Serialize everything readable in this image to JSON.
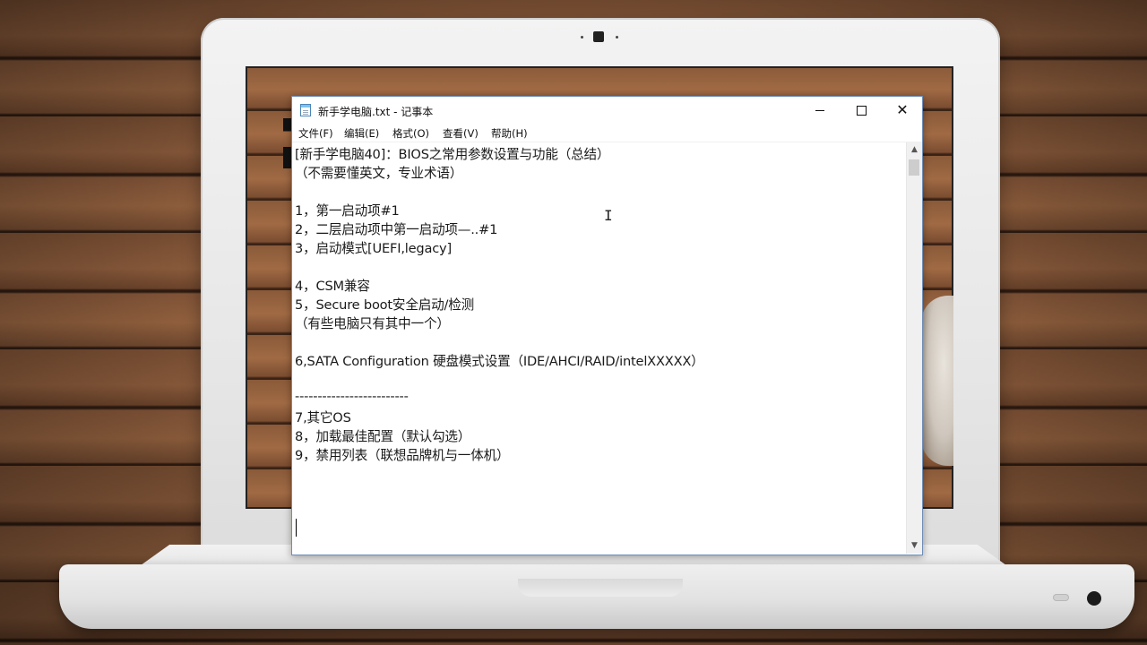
{
  "window": {
    "title": "新手学电脑.txt - 记事本"
  },
  "menu": [
    {
      "label": "文件(F)"
    },
    {
      "label": "编辑(E)"
    },
    {
      "label": "格式(O)"
    },
    {
      "label": "查看(V)"
    },
    {
      "label": "帮助(H)"
    }
  ],
  "document": {
    "lines": [
      "[新手学电脑40]：BIOS之常用参数设置与功能（总结）",
      "（不需要懂英文，专业术语）",
      "",
      "1，第一启动项#1",
      "2，二层启动项中第一启动项—..#1",
      "3，启动模式[UEFI,legacy]",
      "",
      "4，CSM兼容",
      "5，Secure boot安全启动/检测",
      "（有些电脑只有其中一个）",
      "",
      "6,SATA Configuration 硬盘模式设置（IDE/AHCI/RAID/intelXXXXX）",
      "",
      "-------------------------",
      "7,其它OS",
      "8，加载最佳配置（默认勾选）",
      "9，禁用列表（联想品牌机与一体机）"
    ]
  },
  "icons": {
    "minimize": "minimize-icon",
    "maximize": "maximize-icon",
    "close": "close-icon",
    "scroll_up": "chevron-up-icon",
    "scroll_down": "chevron-down-icon"
  }
}
